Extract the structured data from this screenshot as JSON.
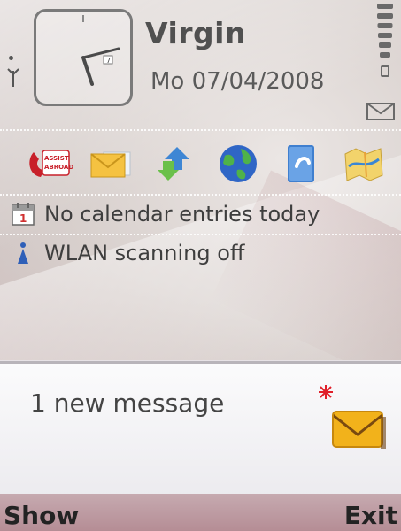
{
  "status": {
    "operator": "Virgin",
    "date": "Mo 07/04/2008"
  },
  "shortcuts": [
    {
      "icon": "assist-abroad-icon"
    },
    {
      "icon": "messaging-icon"
    },
    {
      "icon": "sync-transfer-icon"
    },
    {
      "icon": "web-globe-icon"
    },
    {
      "icon": "contacts-book-icon"
    },
    {
      "icon": "maps-icon"
    }
  ],
  "info": {
    "calendar": "No calendar entries today",
    "wlan": "WLAN scanning off"
  },
  "notification": {
    "text": "1 new message"
  },
  "softkeys": {
    "left": "Show",
    "right": "Exit"
  },
  "colors": {
    "softkey_bar": "#b58d95",
    "accent_red": "#e0202a",
    "mail_yellow": "#f2b21b"
  }
}
